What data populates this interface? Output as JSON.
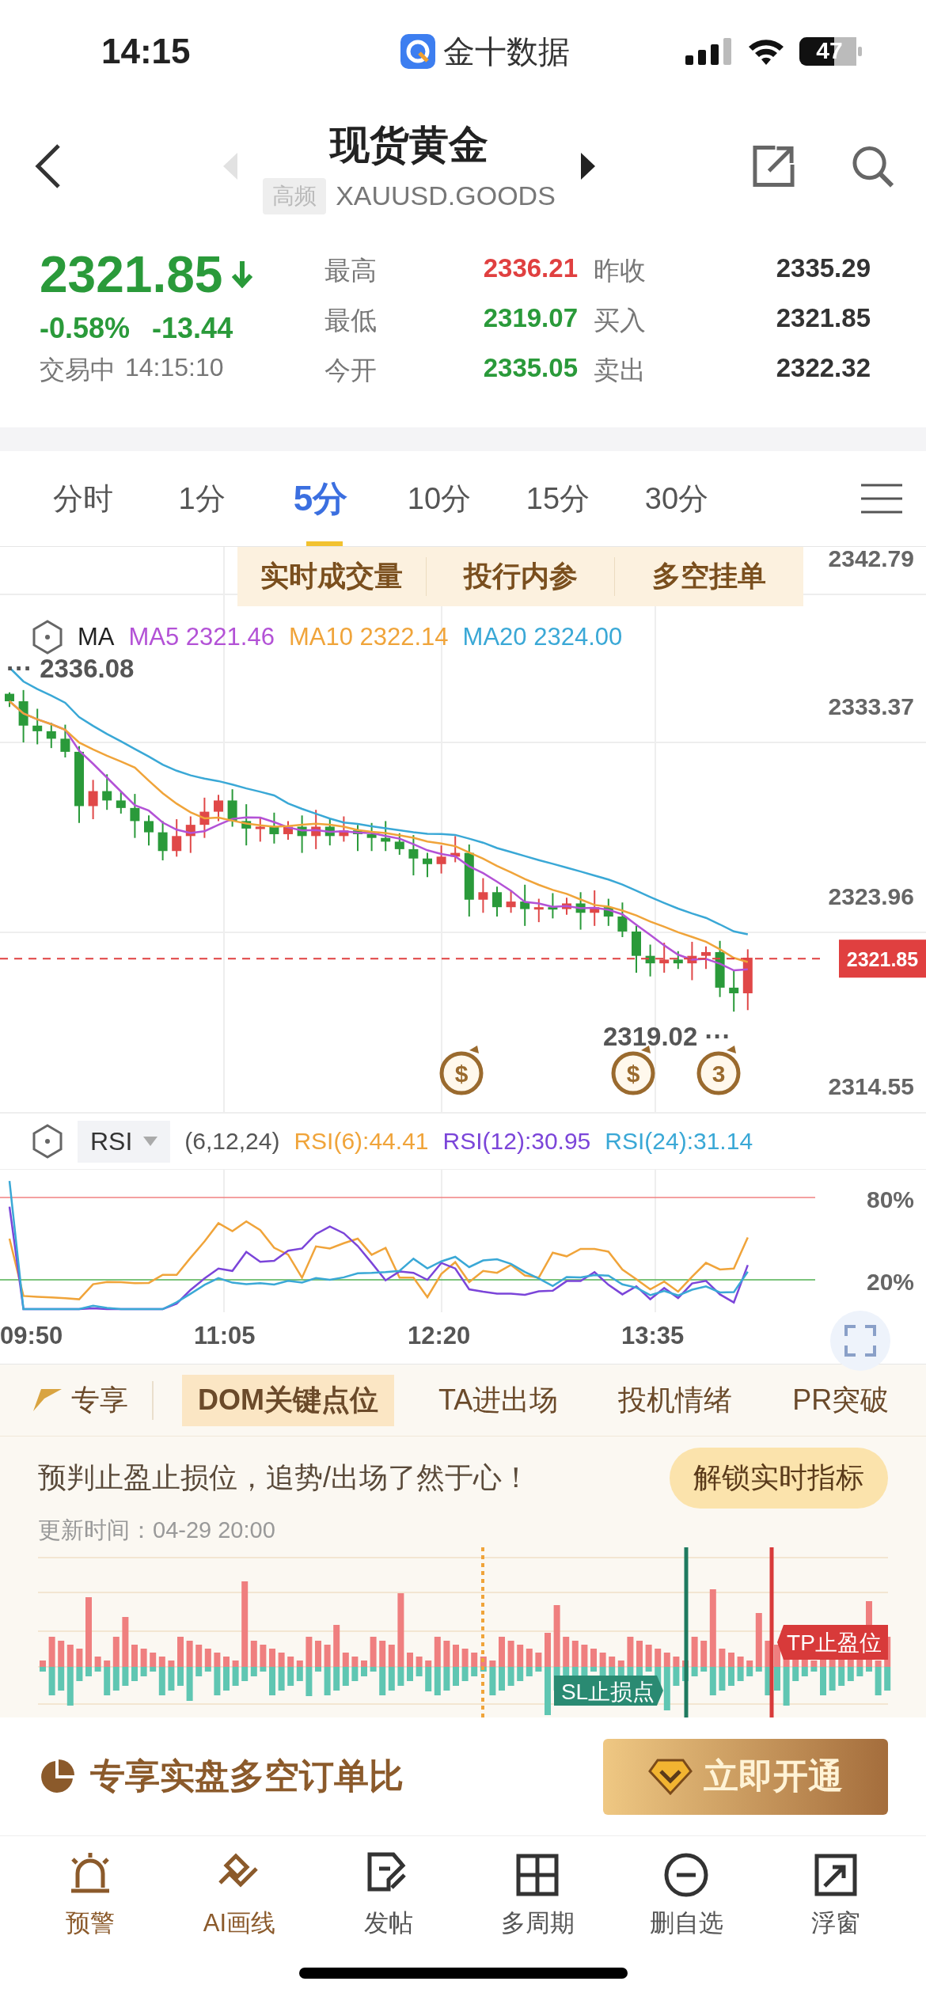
{
  "status_bar": {
    "time": "14:15",
    "app": "金十数据",
    "battery": "47"
  },
  "header": {
    "title": "现货黄金",
    "tag": "高频",
    "symbol": "XAUUSD.GOODS",
    "prev": {
      "disabled": true
    },
    "next": {
      "disabled": false
    }
  },
  "quote": {
    "price": "2321.85",
    "change_pct": "-0.58%",
    "change": "-13.44",
    "status": "交易中",
    "time": "14:15:10",
    "stats": [
      {
        "label": "最高",
        "value": "2336.21",
        "color": "#e04040"
      },
      {
        "label": "昨收",
        "value": "2335.29",
        "color": "#333333"
      },
      {
        "label": "最低",
        "value": "2319.07",
        "color": "#2a9a3a"
      },
      {
        "label": "买入",
        "value": "2321.85",
        "color": "#333333"
      },
      {
        "label": "今开",
        "value": "2335.05",
        "color": "#2a9a3a"
      },
      {
        "label": "卖出",
        "value": "2322.32",
        "color": "#333333"
      }
    ]
  },
  "periods": [
    {
      "label": "分时",
      "selected": false
    },
    {
      "label": "1分",
      "selected": false
    },
    {
      "label": "5分",
      "selected": true
    },
    {
      "label": "10分",
      "selected": false
    },
    {
      "label": "15分",
      "selected": false
    },
    {
      "label": "30分",
      "selected": false
    }
  ],
  "chart": {
    "tabs": [
      "实时成交量",
      "投行内参",
      "多空挂单"
    ],
    "legend_label": "MA",
    "ma": [
      {
        "label": "MA5 2321.46",
        "color": "#b352d6"
      },
      {
        "label": "MA10 2322.14",
        "color": "#f0a43a"
      },
      {
        "label": "MA20 2324.00",
        "color": "#3aa8d6"
      }
    ],
    "price_axis": [
      "2342.79",
      "2333.37",
      "2323.96",
      "2314.55"
    ],
    "high_marker": "··· 2336.08",
    "low_marker": "2319.02 ···",
    "current_price": "2321.85",
    "events": [
      {
        "glyph": "$"
      },
      {
        "glyph": "$"
      },
      {
        "glyph": "3"
      }
    ]
  },
  "rsi": {
    "indicator": "RSI",
    "params": "(6,12,24)",
    "values": [
      {
        "label": "RSI(6):44.41",
        "color": "#f0a43a"
      },
      {
        "label": "RSI(12):30.95",
        "color": "#7b45d9"
      },
      {
        "label": "RSI(24):31.14",
        "color": "#3aa8d6"
      }
    ],
    "levels": [
      "80%",
      "20%"
    ]
  },
  "time_axis": [
    "09:50",
    "11:05",
    "12:20",
    "13:35"
  ],
  "indicator_tabs": {
    "lead": "专享",
    "tabs": [
      {
        "label": "DOM关键点位",
        "selected": true
      },
      {
        "label": "TA进出场",
        "selected": false
      },
      {
        "label": "投机情绪",
        "selected": false
      },
      {
        "label": "PR突破",
        "selected": false
      }
    ]
  },
  "dom": {
    "headline": "预判止盈止损位，追势/出场了然于心！",
    "unlock_button": "解锁实时指标",
    "updated": "更新时间：04-29 20:00",
    "tp_label": "TP止盈位",
    "sl_label": "SL止损点"
  },
  "promo": {
    "title": "专享实盘多空订单比",
    "button": "立即开通"
  },
  "nav": [
    {
      "label": "预警",
      "accent": true
    },
    {
      "label": "AI画线",
      "accent": true
    },
    {
      "label": "发帖",
      "accent": false
    },
    {
      "label": "多周期",
      "accent": false
    },
    {
      "label": "删自选",
      "accent": false
    },
    {
      "label": "浮窗",
      "accent": false
    }
  ]
}
